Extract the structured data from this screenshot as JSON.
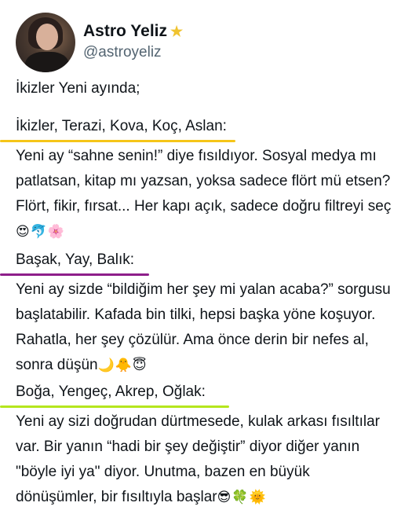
{
  "profile": {
    "name": "Astro Yeliz",
    "badge_icon": "star-icon",
    "handle": "@astroyeliz"
  },
  "intro": "İkizler Yeni ayında;",
  "sections": [
    {
      "title": "İkizler, Terazi, Kova, Koç, Aslan:",
      "underline_color": "#f5c518",
      "lines": [
        "Yeni ay “sahne senin!” diye fısıldıyor. Sosyal medya mı",
        "patlatsan, kitap mı yazsan, yoksa sadece flört mü etsen?",
        "Flört, fikir, fırsat... Her kapı açık, sadece doğru filtreyi seç"
      ],
      "emojis": "😍🐬🌸"
    },
    {
      "title": "Başak, Yay, Balık:",
      "underline_color": "#8e1f8a",
      "lines": [
        "Yeni ay sizde “bildiğim her şey mi yalan acaba?” sorgusu",
        "başlatabilir. Kafada bin tilki, hepsi başka yöne koşuyor.",
        "Rahatla, her şey çözülür. Ama önce derin bir nefes al,"
      ],
      "last_line": "sonra düşün",
      "emojis": "🌙🐥😇"
    },
    {
      "title": "Boğa, Yengeç, Akrep, Oğlak:",
      "underline_color": "#b5e61d",
      "lines": [
        "Yeni ay sizi doğrudan dürtmesede, kulak arkası fısıltılar",
        "var. Bir yanın “hadi bir şey değiştir” diyor  diğer yanın",
        "\"böyle iyi ya\" diyor. Unutma, bazen en büyük"
      ],
      "last_line": "dönüşümler, bir fısıltıyla başlar",
      "emojis": "😎🍀🌞"
    }
  ]
}
